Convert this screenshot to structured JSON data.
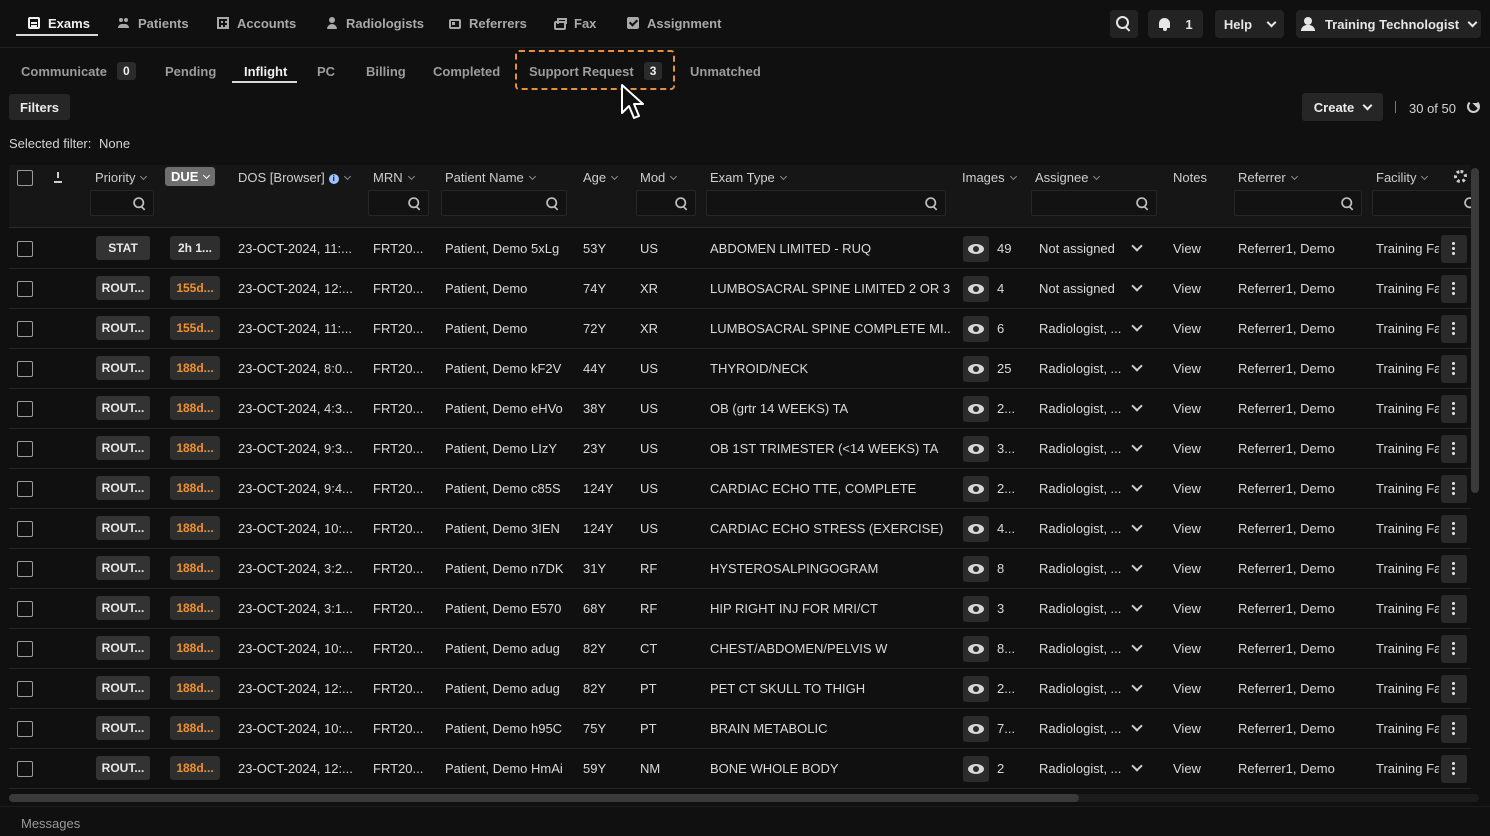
{
  "nav": {
    "items": [
      {
        "label": "Exams",
        "icon": "exams-icon"
      },
      {
        "label": "Patients",
        "icon": "patients-icon"
      },
      {
        "label": "Accounts",
        "icon": "accounts-icon"
      },
      {
        "label": "Radiologists",
        "icon": "radiologist-icon"
      },
      {
        "label": "Referrers",
        "icon": "referrers-icon"
      },
      {
        "label": "Fax",
        "icon": "fax-icon"
      },
      {
        "label": "Assignment",
        "icon": "assignment-icon"
      }
    ],
    "notification_count": "1",
    "help_label": "Help",
    "user_label": "Training Technologist"
  },
  "tabs": [
    {
      "label": "Communicate",
      "count": "0"
    },
    {
      "label": "Pending"
    },
    {
      "label": "Inflight"
    },
    {
      "label": "PC"
    },
    {
      "label": "Billing"
    },
    {
      "label": "Completed"
    },
    {
      "label": "Support Request",
      "count": "3"
    },
    {
      "label": "Unmatched"
    }
  ],
  "active_tab": "Inflight",
  "toolbar": {
    "filters_label": "Filters",
    "selected_filter_label": "Selected filter:",
    "selected_filter_value": "None",
    "create_label": "Create",
    "page_count": "30 of 50"
  },
  "table": {
    "headers": {
      "priority": "Priority",
      "due": "DUE",
      "dos": "DOS [Browser]",
      "mrn": "MRN",
      "patient": "Patient Name",
      "age": "Age",
      "mod": "Mod",
      "exam": "Exam Type",
      "images": "Images",
      "assignee": "Assignee",
      "notes": "Notes",
      "referrer": "Referrer",
      "facility": "Facility"
    },
    "rows": [
      {
        "priority": "STAT",
        "due": "2h 1...",
        "due_color": "#e8e8e8",
        "dos": "23-OCT-2024, 11:...",
        "mrn": "FRT20...",
        "patient": "Patient, Demo 5xLg",
        "age": "53Y",
        "mod": "US",
        "exam": "ABDOMEN LIMITED - RUQ",
        "images": "49",
        "assignee": "Not assigned",
        "notes": "View",
        "referrer": "Referrer1, Demo",
        "facility": "Training Fa"
      },
      {
        "priority": "ROUT...",
        "due": "155d...",
        "due_color": "#f0912e",
        "dos": "23-OCT-2024, 12:...",
        "mrn": "FRT20...",
        "patient": "Patient, Demo",
        "age": "74Y",
        "mod": "XR",
        "exam": "LUMBOSACRAL SPINE LIMITED 2 OR 3...",
        "images": "4",
        "assignee": "Not assigned",
        "notes": "View",
        "referrer": "Referrer1, Demo",
        "facility": "Training Fa"
      },
      {
        "priority": "ROUT...",
        "due": "155d...",
        "due_color": "#f0912e",
        "dos": "23-OCT-2024, 11:...",
        "mrn": "FRT20...",
        "patient": "Patient, Demo",
        "age": "72Y",
        "mod": "XR",
        "exam": "LUMBOSACRAL SPINE COMPLETE MI...",
        "images": "6",
        "assignee": "Radiologist, ...",
        "notes": "View",
        "referrer": "Referrer1, Demo",
        "facility": "Training Fa"
      },
      {
        "priority": "ROUT...",
        "due": "188d...",
        "due_color": "#f0912e",
        "dos": "23-OCT-2024, 8:0...",
        "mrn": "FRT20...",
        "patient": "Patient, Demo kF2V",
        "age": "44Y",
        "mod": "US",
        "exam": "THYROID/NECK",
        "images": "25",
        "assignee": "Radiologist, ...",
        "notes": "View",
        "referrer": "Referrer1, Demo",
        "facility": "Training Fa"
      },
      {
        "priority": "ROUT...",
        "due": "188d...",
        "due_color": "#f0912e",
        "dos": "23-OCT-2024, 4:3...",
        "mrn": "FRT20...",
        "patient": "Patient, Demo eHVo",
        "age": "38Y",
        "mod": "US",
        "exam": "OB (grtr 14 WEEKS) TA",
        "images": "2...",
        "assignee": "Radiologist, ...",
        "notes": "View",
        "referrer": "Referrer1, Demo",
        "facility": "Training Fa"
      },
      {
        "priority": "ROUT...",
        "due": "188d...",
        "due_color": "#f0912e",
        "dos": "23-OCT-2024, 9:3...",
        "mrn": "FRT20...",
        "patient": "Patient, Demo LIzY",
        "age": "23Y",
        "mod": "US",
        "exam": "OB 1ST TRIMESTER (<14 WEEKS) TA",
        "images": "3...",
        "assignee": "Radiologist, ...",
        "notes": "View",
        "referrer": "Referrer1, Demo",
        "facility": "Training Fa"
      },
      {
        "priority": "ROUT...",
        "due": "188d...",
        "due_color": "#f0912e",
        "dos": "23-OCT-2024, 9:4...",
        "mrn": "FRT20...",
        "patient": "Patient, Demo c85S",
        "age": "124Y",
        "mod": "US",
        "exam": "CARDIAC ECHO TTE, COMPLETE",
        "images": "2...",
        "assignee": "Radiologist, ...",
        "notes": "View",
        "referrer": "Referrer1, Demo",
        "facility": "Training Fa"
      },
      {
        "priority": "ROUT...",
        "due": "188d...",
        "due_color": "#f0912e",
        "dos": "23-OCT-2024, 10:...",
        "mrn": "FRT20...",
        "patient": "Patient, Demo 3IEN",
        "age": "124Y",
        "mod": "US",
        "exam": "CARDIAC ECHO STRESS (EXERCISE)",
        "images": "4...",
        "assignee": "Radiologist, ...",
        "notes": "View",
        "referrer": "Referrer1, Demo",
        "facility": "Training Fa"
      },
      {
        "priority": "ROUT...",
        "due": "188d...",
        "due_color": "#f0912e",
        "dos": "23-OCT-2024, 3:2...",
        "mrn": "FRT20...",
        "patient": "Patient, Demo n7DK",
        "age": "31Y",
        "mod": "RF",
        "exam": "HYSTEROSALPINGOGRAM",
        "images": "8",
        "assignee": "Radiologist, ...",
        "notes": "View",
        "referrer": "Referrer1, Demo",
        "facility": "Training Fa"
      },
      {
        "priority": "ROUT...",
        "due": "188d...",
        "due_color": "#f0912e",
        "dos": "23-OCT-2024, 3:1...",
        "mrn": "FRT20...",
        "patient": "Patient, Demo E570",
        "age": "68Y",
        "mod": "RF",
        "exam": "HIP RIGHT INJ FOR MRI/CT",
        "images": "3",
        "assignee": "Radiologist, ...",
        "notes": "View",
        "referrer": "Referrer1, Demo",
        "facility": "Training Fa"
      },
      {
        "priority": "ROUT...",
        "due": "188d...",
        "due_color": "#f0912e",
        "dos": "23-OCT-2024, 10:...",
        "mrn": "FRT20...",
        "patient": "Patient, Demo adug",
        "age": "82Y",
        "mod": "CT",
        "exam": "CHEST/ABDOMEN/PELVIS W",
        "images": "8...",
        "assignee": "Radiologist, ...",
        "notes": "View",
        "referrer": "Referrer1, Demo",
        "facility": "Training Fa"
      },
      {
        "priority": "ROUT...",
        "due": "188d...",
        "due_color": "#f0912e",
        "dos": "23-OCT-2024, 12:...",
        "mrn": "FRT20...",
        "patient": "Patient, Demo adug",
        "age": "82Y",
        "mod": "PT",
        "exam": "PET CT SKULL TO THIGH",
        "images": "2...",
        "assignee": "Radiologist, ...",
        "notes": "View",
        "referrer": "Referrer1, Demo",
        "facility": "Training Fa"
      },
      {
        "priority": "ROUT...",
        "due": "188d...",
        "due_color": "#f0912e",
        "dos": "23-OCT-2024, 10:...",
        "mrn": "FRT20...",
        "patient": "Patient, Demo h95C",
        "age": "75Y",
        "mod": "PT",
        "exam": "BRAIN METABOLIC",
        "images": "7...",
        "assignee": "Radiologist, ...",
        "notes": "View",
        "referrer": "Referrer1, Demo",
        "facility": "Training Fa"
      },
      {
        "priority": "ROUT...",
        "due": "188d...",
        "due_color": "#f0912e",
        "dos": "23-OCT-2024, 12:...",
        "mrn": "FRT20...",
        "patient": "Patient, Demo HmAi",
        "age": "59Y",
        "mod": "NM",
        "exam": "BONE WHOLE BODY",
        "images": "2",
        "assignee": "Radiologist, ...",
        "notes": "View",
        "referrer": "Referrer1, Demo",
        "facility": "Training Fa"
      }
    ]
  },
  "footer": {
    "messages_label": "Messages"
  },
  "colors": {
    "background": "#101010",
    "due_overdue": "#f0912e",
    "highlight": "#e7903a"
  }
}
